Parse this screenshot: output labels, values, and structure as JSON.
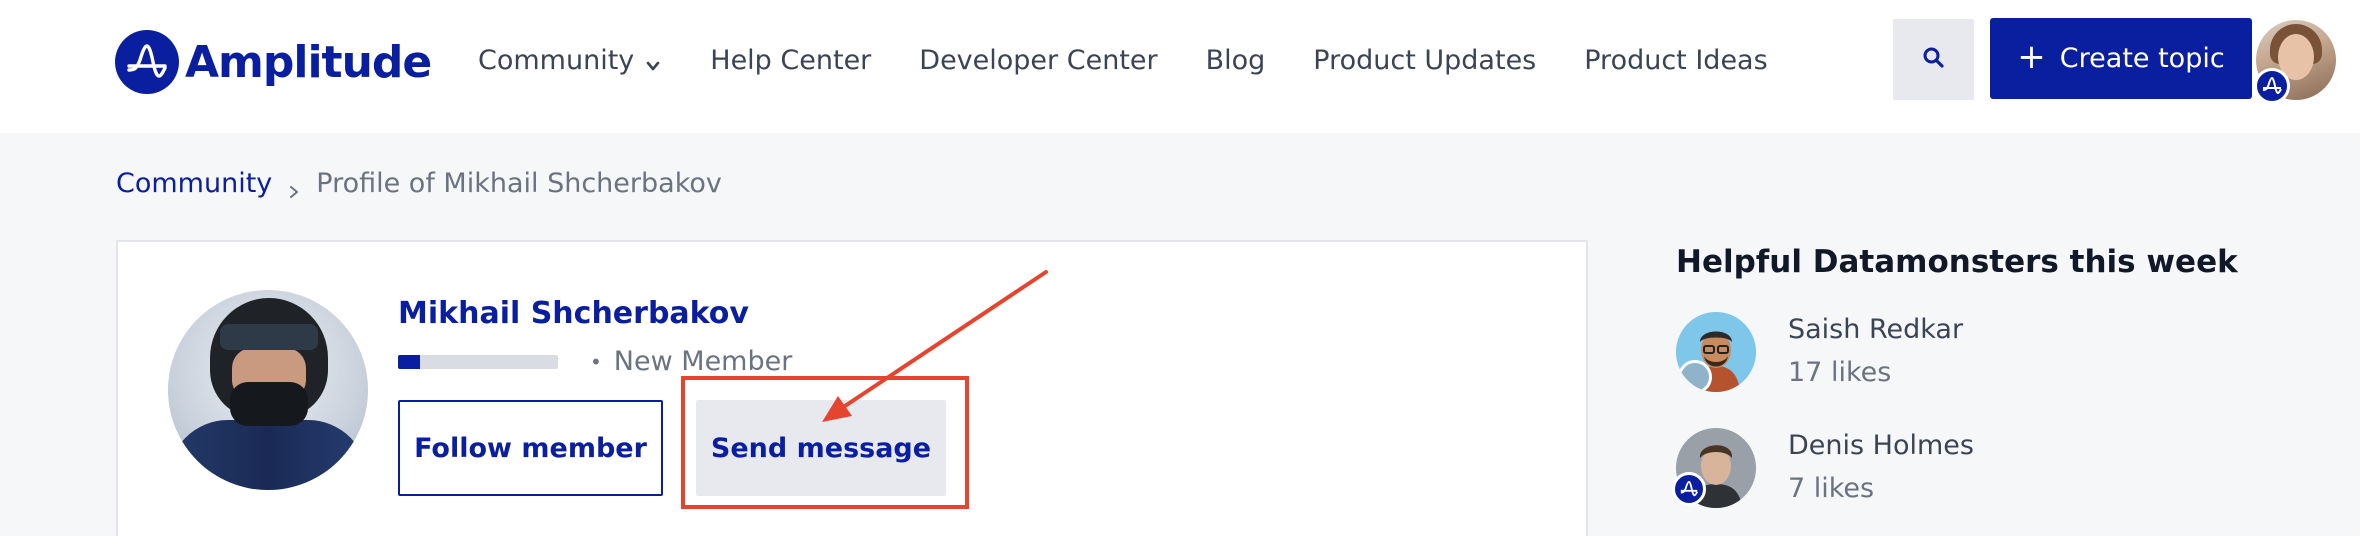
{
  "header": {
    "brand": "Amplitude",
    "nav": [
      {
        "label": "Community"
      },
      {
        "label": "Help Center"
      },
      {
        "label": "Developer Center"
      },
      {
        "label": "Blog"
      },
      {
        "label": "Product Updates"
      },
      {
        "label": "Product Ideas"
      }
    ],
    "create_label": "Create topic",
    "icons": {
      "search": "search-icon",
      "chevron": "chevron-down-icon",
      "plus": "plus-icon"
    }
  },
  "breadcrumb": {
    "root": "Community",
    "current": "Profile of Mikhail Shcherbakov"
  },
  "profile": {
    "name": "Mikhail Shcherbakov",
    "rank": "New Member",
    "rank_progress": 0.14,
    "follow_label": "Follow member",
    "message_label": "Send message"
  },
  "sidebar": {
    "title": "Helpful Datamonsters this week",
    "helpers": [
      {
        "name": "Saish Redkar",
        "likes": "17 likes"
      },
      {
        "name": "Denis Holmes",
        "likes": "7 likes"
      }
    ]
  },
  "colors": {
    "brand": "#0a1fa0",
    "annotation": "#e5452e"
  }
}
